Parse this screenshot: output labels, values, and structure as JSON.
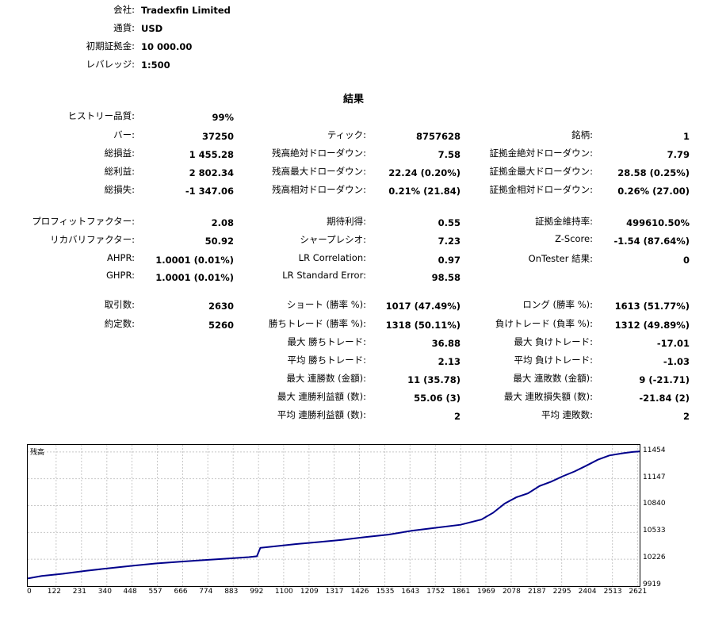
{
  "header": [
    {
      "label": "会社:",
      "value": "Tradexfin Limited"
    },
    {
      "label": "通貨:",
      "value": "USD"
    },
    {
      "label": "初期証拠金:",
      "value": "10 000.00"
    },
    {
      "label": "レバレッジ:",
      "value": "1:500"
    }
  ],
  "results_title": "結果",
  "col1": [
    {
      "label": "ヒストリー品質:",
      "value": "99%"
    },
    {
      "label": "バー:",
      "value": "37250"
    },
    {
      "label": "総損益:",
      "value": "1 455.28"
    },
    {
      "label": "総利益:",
      "value": "2 802.34"
    },
    {
      "label": "総損失:",
      "value": "-1 347.06"
    },
    {
      "label": "プロフィットファクター:",
      "value": "2.08"
    },
    {
      "label": "リカバリファクター:",
      "value": "50.92"
    },
    {
      "label": "AHPR:",
      "value": "1.0001 (0.01%)"
    },
    {
      "label": "GHPR:",
      "value": "1.0001 (0.01%)"
    },
    {
      "label": "取引数:",
      "value": "2630"
    },
    {
      "label": "約定数:",
      "value": "5260"
    }
  ],
  "col2": [
    {
      "label": "ティック:",
      "value": "8757628"
    },
    {
      "label": "残高絶対ドローダウン:",
      "value": "7.58"
    },
    {
      "label": "残高最大ドローダウン:",
      "value": "22.24 (0.20%)"
    },
    {
      "label": "残高相対ドローダウン:",
      "value": "0.21% (21.84)"
    },
    {
      "label": "期待利得:",
      "value": "0.55"
    },
    {
      "label": "シャープレシオ:",
      "value": "7.23"
    },
    {
      "label": "LR Correlation:",
      "value": "0.97"
    },
    {
      "label": "LR Standard Error:",
      "value": "98.58"
    },
    {
      "label": "ショート (勝率 %):",
      "value": "1017 (47.49%)"
    },
    {
      "label": "勝ちトレード (勝率 %):",
      "value": "1318 (50.11%)"
    },
    {
      "label": "最大 勝ちトレード:",
      "value": "36.88"
    },
    {
      "label": "平均 勝ちトレード:",
      "value": "2.13"
    },
    {
      "label": "最大 連勝数 (金額):",
      "value": "11 (35.78)"
    },
    {
      "label": "最大 連勝利益額 (数):",
      "value": "55.06 (3)"
    },
    {
      "label": "平均 連勝利益額 (数):",
      "value": "2"
    }
  ],
  "col3": [
    {
      "label": "銘柄:",
      "value": "1"
    },
    {
      "label": "証拠金絶対ドローダウン:",
      "value": "7.79"
    },
    {
      "label": "証拠金最大ドローダウン:",
      "value": "28.58 (0.25%)"
    },
    {
      "label": "証拠金相対ドローダウン:",
      "value": "0.26% (27.00)"
    },
    {
      "label": "証拠金維持率:",
      "value": "499610.50%"
    },
    {
      "label": "Z-Score:",
      "value": "-1.54 (87.64%)"
    },
    {
      "label": "OnTester 結果:",
      "value": "0"
    },
    {
      "label": "ロング (勝率 %):",
      "value": "1613 (51.77%)"
    },
    {
      "label": "負けトレード (負率 %):",
      "value": "1312 (49.89%)"
    },
    {
      "label": "最大 負けトレード:",
      "value": "-17.01"
    },
    {
      "label": "平均 負けトレード:",
      "value": "-1.03"
    },
    {
      "label": "最大 連敗数 (金額):",
      "value": "9 (-21.71)"
    },
    {
      "label": "最大 連敗損失額 (数):",
      "value": "-21.84 (2)"
    },
    {
      "label": "平均 連敗数:",
      "value": "2"
    }
  ],
  "chart_data": {
    "type": "line",
    "title": "残高",
    "x_ticks": [
      "0",
      "122",
      "231",
      "340",
      "448",
      "557",
      "666",
      "774",
      "883",
      "992",
      "1100",
      "1209",
      "1317",
      "1426",
      "1535",
      "1643",
      "1752",
      "1861",
      "1969",
      "2078",
      "2187",
      "2295",
      "2404",
      "2513",
      "2621"
    ],
    "y_ticks": [
      "11454",
      "11147",
      "10840",
      "10533",
      "10226",
      "9919"
    ],
    "xlim": [
      0,
      2630
    ],
    "ylim": [
      9919,
      11534
    ],
    "grid": true,
    "line_color": "#00008b",
    "series": [
      {
        "x": [
          0,
          60,
          150,
          250,
          350,
          450,
          550,
          650,
          750,
          850,
          950,
          985,
          1000,
          1050,
          1150,
          1250,
          1350,
          1450,
          1550,
          1650,
          1750,
          1860,
          1950,
          2000,
          2050,
          2100,
          2150,
          2200,
          2250,
          2300,
          2350,
          2400,
          2450,
          2500,
          2560,
          2600,
          2630
        ],
        "y": [
          10006,
          10034,
          10060,
          10094,
          10123,
          10151,
          10178,
          10197,
          10215,
          10232,
          10250,
          10260,
          10356,
          10371,
          10399,
          10423,
          10448,
          10479,
          10508,
          10551,
          10585,
          10620,
          10680,
          10757,
          10863,
          10934,
          10980,
          11064,
          11114,
          11176,
          11230,
          11295,
          11364,
          11413,
          11440,
          11453,
          11460
        ]
      }
    ]
  }
}
